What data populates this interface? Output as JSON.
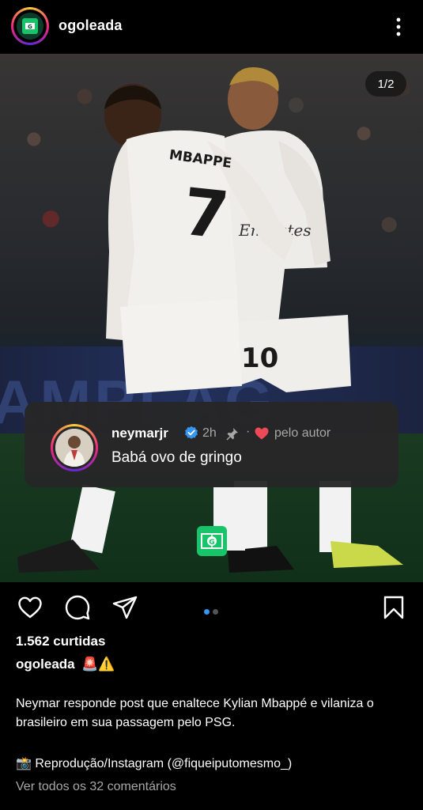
{
  "header": {
    "username": "ogoleada",
    "avatar_icon": "goleada-logo-icon",
    "more_icon": "more-vertical-icon"
  },
  "post": {
    "carousel_counter": "1/2",
    "carousel_index": 1,
    "carousel_total": 2,
    "photo_banner_text": "AMPI   AG",
    "jersey_left": {
      "name": "MBAPPE",
      "number": "7"
    },
    "jersey_right": {
      "number": "10",
      "sponsor": "Emirates"
    },
    "watermark_icon": "goleada-watermark-icon"
  },
  "pinned_comment": {
    "username": "neymarjr",
    "verified_icon": "verified-badge-icon",
    "time": "2h",
    "pin_icon": "pin-icon",
    "separator": "·",
    "heart_icon": "heart-filled-icon",
    "author_label": "pelo autor",
    "text": "Babá ovo de gringo"
  },
  "actions": {
    "like_icon": "heart-outline-icon",
    "comment_icon": "comment-icon",
    "share_icon": "send-icon",
    "save_icon": "bookmark-icon"
  },
  "engagement": {
    "likes": "1.562 curtidas"
  },
  "caption": {
    "username": "ogoleada",
    "emoji": "🚨⚠️",
    "body": "Neymar responde post que enaltece Kylian Mbappé e vilaniza o brasileiro em sua passagem pelo PSG.",
    "credit": "📸 Reprodução/Instagram (@fiqueiputomesmo_)",
    "view_comments": "Ver todos os 32 comentários"
  },
  "colors": {
    "background": "#000000",
    "accent_blue": "#3797f0",
    "heart_red": "#ed4956",
    "secondary_text": "#a8a8a8",
    "comment_bubble": "#262626",
    "brand_green": "#18c46a"
  }
}
